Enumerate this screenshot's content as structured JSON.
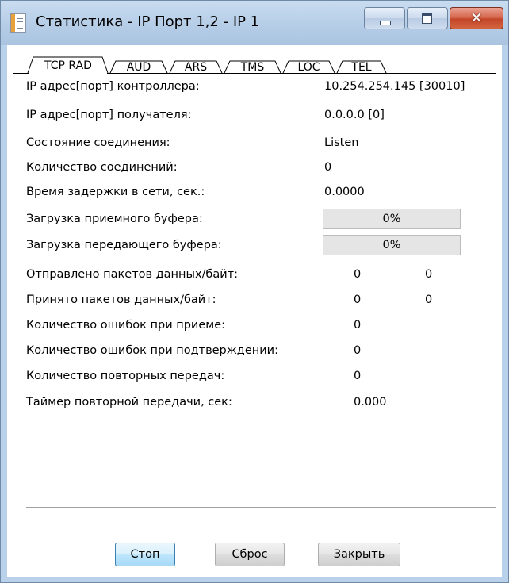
{
  "window": {
    "title": "Статистика - IP Порт 1,2 - IP 1",
    "close_glyph": "✕"
  },
  "tabs": [
    {
      "label": "TCP RAD",
      "selected": true
    },
    {
      "label": "AUD"
    },
    {
      "label": "ARS"
    },
    {
      "label": "TMS"
    },
    {
      "label": "LOC"
    },
    {
      "label": "TEL"
    }
  ],
  "stats": {
    "controller_ip_label": "IP адрес[порт] контроллера:",
    "controller_ip_value": "10.254.254.145 [30010]",
    "receiver_ip_label": "IP адрес[порт] получателя:",
    "receiver_ip_value": "0.0.0.0 [0]",
    "connection_state_label": "Состояние соединения:",
    "connection_state_value": "Listen",
    "connection_count_label": "Количество соединений:",
    "connection_count_value": "0",
    "network_delay_label": "Время задержки в сети, сек.:",
    "network_delay_value": "0.0000",
    "rx_buffer_label": "Загрузка приемного буфера:",
    "rx_buffer_value": "0%",
    "rx_buffer_fraction": 0,
    "tx_buffer_label": "Загрузка передающего буфера:",
    "tx_buffer_value": "0%",
    "tx_buffer_fraction": 0,
    "sent_label": "Отправлено пакетов данных/байт:",
    "sent_packets": "0",
    "sent_bytes": "0",
    "received_label": "Принято пакетов данных/байт:",
    "received_packets": "0",
    "received_bytes": "0",
    "rx_errors_label": "Количество ошибок при приеме:",
    "rx_errors_value": "0",
    "ack_errors_label": "Количество ошибок при подтверждении:",
    "ack_errors_value": "0",
    "retransmit_count_label": "Количество повторных передач:",
    "retransmit_count_value": "0",
    "retransmit_timer_label": "Таймер повторной передачи, сек:",
    "retransmit_timer_value": "0.000"
  },
  "buttons": {
    "stop": "Стоп",
    "reset": "Сброс",
    "close": "Закрыть"
  },
  "colors": {
    "title_bg": "#b9d1ea",
    "default_button": "#bee6fd",
    "progress_fill": "#06b025"
  }
}
